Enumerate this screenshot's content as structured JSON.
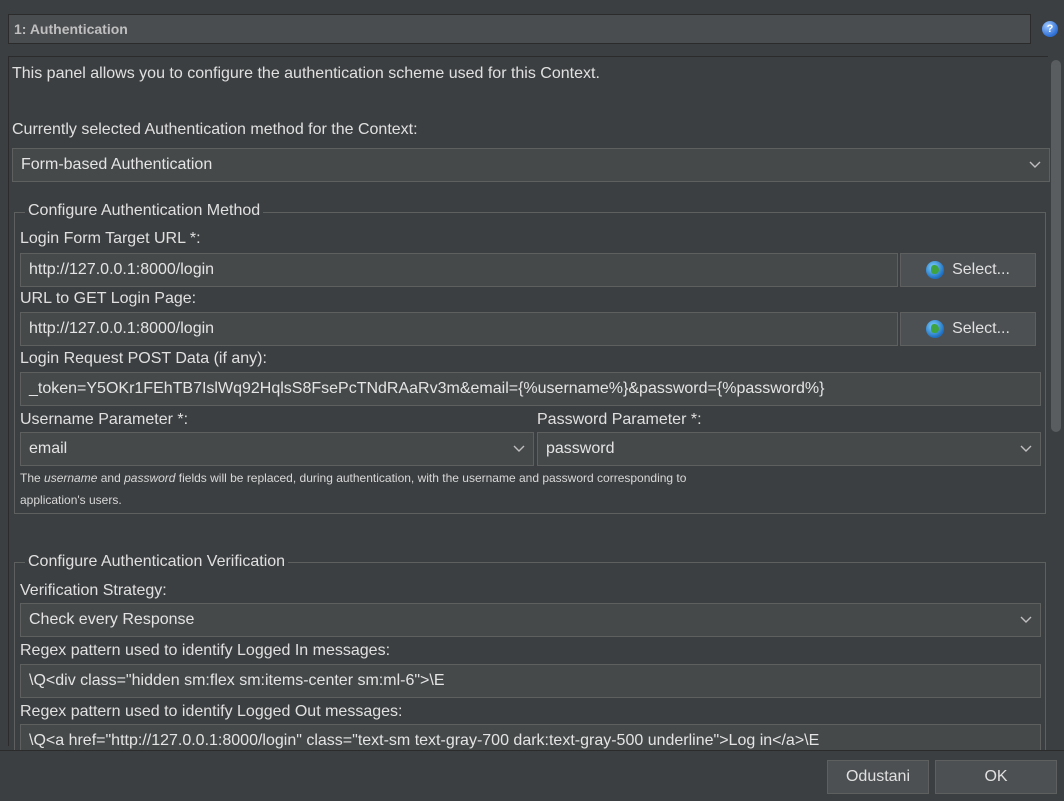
{
  "panel": {
    "title": "1: Authentication",
    "description": "This panel allows you to configure the authentication scheme used for this Context.",
    "method_label": "Currently selected Authentication method for the Context:",
    "method_value": "Form-based Authentication"
  },
  "config_method": {
    "group_title": "Configure Authentication Method",
    "target_url_label": "Login Form Target URL *:",
    "target_url_value": "http://127.0.0.1:8000/login",
    "select_label_1": "Select...",
    "get_url_label": "URL to GET Login Page:",
    "get_url_value": "http://127.0.0.1:8000/login",
    "select_label_2": "Select...",
    "post_data_label": "Login Request POST Data (if any):",
    "post_data_value": "_token=Y5OKr1FEhTB7IslWq92HqlsS8FsePcTNdRAaRv3m&email={%username%}&password={%password%}",
    "username_param_label": "Username Parameter *:",
    "username_param_value": "email",
    "password_param_label": "Password Parameter *:",
    "password_param_value": "password",
    "note_prefix": "The ",
    "note_username": "username",
    "note_and": " and ",
    "note_password": "password",
    "note_rest": " fields will be replaced, during authentication, with the username and password corresponding to",
    "note_line2": "application's users."
  },
  "config_verification": {
    "group_title": "Configure Authentication Verification",
    "strategy_label": "Verification Strategy:",
    "strategy_value": "Check every Response",
    "logged_in_label": "Regex pattern used to identify Logged In messages:",
    "logged_in_value": "\\Q<div class=\"hidden sm:flex sm:items-center sm:ml-6\">\\E",
    "logged_out_label": "Regex pattern used to identify Logged Out messages:",
    "logged_out_value": "\\Q<a href=\"http://127.0.0.1:8000/login\" class=\"text-sm text-gray-700 dark:text-gray-500 underline\">Log in</a>\\E"
  },
  "footer": {
    "cancel_label": "Odustani",
    "ok_label": "OK"
  },
  "icons": {
    "help": "help-icon",
    "globe": "globe-icon",
    "dropdown": "chevron-down-icon"
  },
  "colors": {
    "background": "#3c3f41",
    "field": "#45494a",
    "border": "#5e6060",
    "text": "#e0e0e0"
  }
}
